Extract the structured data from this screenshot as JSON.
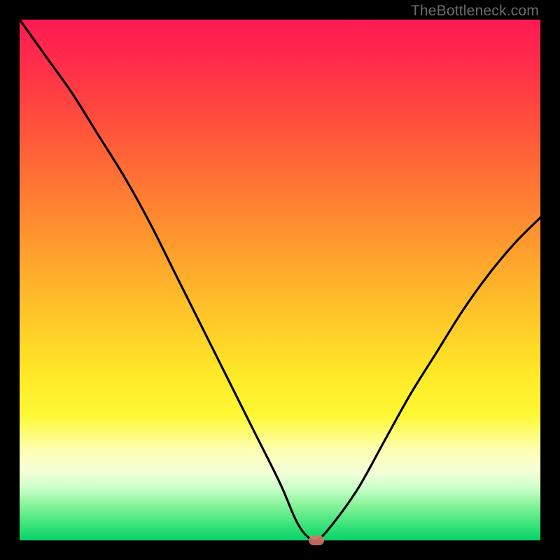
{
  "watermark": "TheBottleneck.com",
  "colors": {
    "frame": "#000000",
    "curve": "#000000",
    "marker": "#d8766d"
  },
  "chart_data": {
    "type": "line",
    "title": "",
    "xlabel": "",
    "ylabel": "",
    "xlim": [
      0,
      100
    ],
    "ylim": [
      0,
      100
    ],
    "grid": false,
    "series": [
      {
        "name": "bottleneck-curve",
        "x": [
          0,
          5,
          10,
          15,
          20,
          25,
          30,
          35,
          40,
          45,
          50,
          53,
          55,
          57,
          60,
          65,
          70,
          75,
          80,
          85,
          90,
          95,
          100
        ],
        "y": [
          100,
          93,
          86,
          78,
          70,
          61,
          51,
          41,
          31,
          21,
          11,
          4,
          1,
          0,
          3,
          10,
          19,
          28,
          36,
          44,
          51,
          57,
          62
        ]
      }
    ],
    "marker": {
      "x": 57,
      "y": 0
    },
    "annotations": [],
    "background_gradient": {
      "direction": "vertical",
      "stops": [
        {
          "pos": 0,
          "color": "#ff1a52"
        },
        {
          "pos": 38,
          "color": "#ff8a30"
        },
        {
          "pos": 68,
          "color": "#ffe828"
        },
        {
          "pos": 87,
          "color": "#f4ffd8"
        },
        {
          "pos": 100,
          "color": "#0cd068"
        }
      ]
    }
  }
}
